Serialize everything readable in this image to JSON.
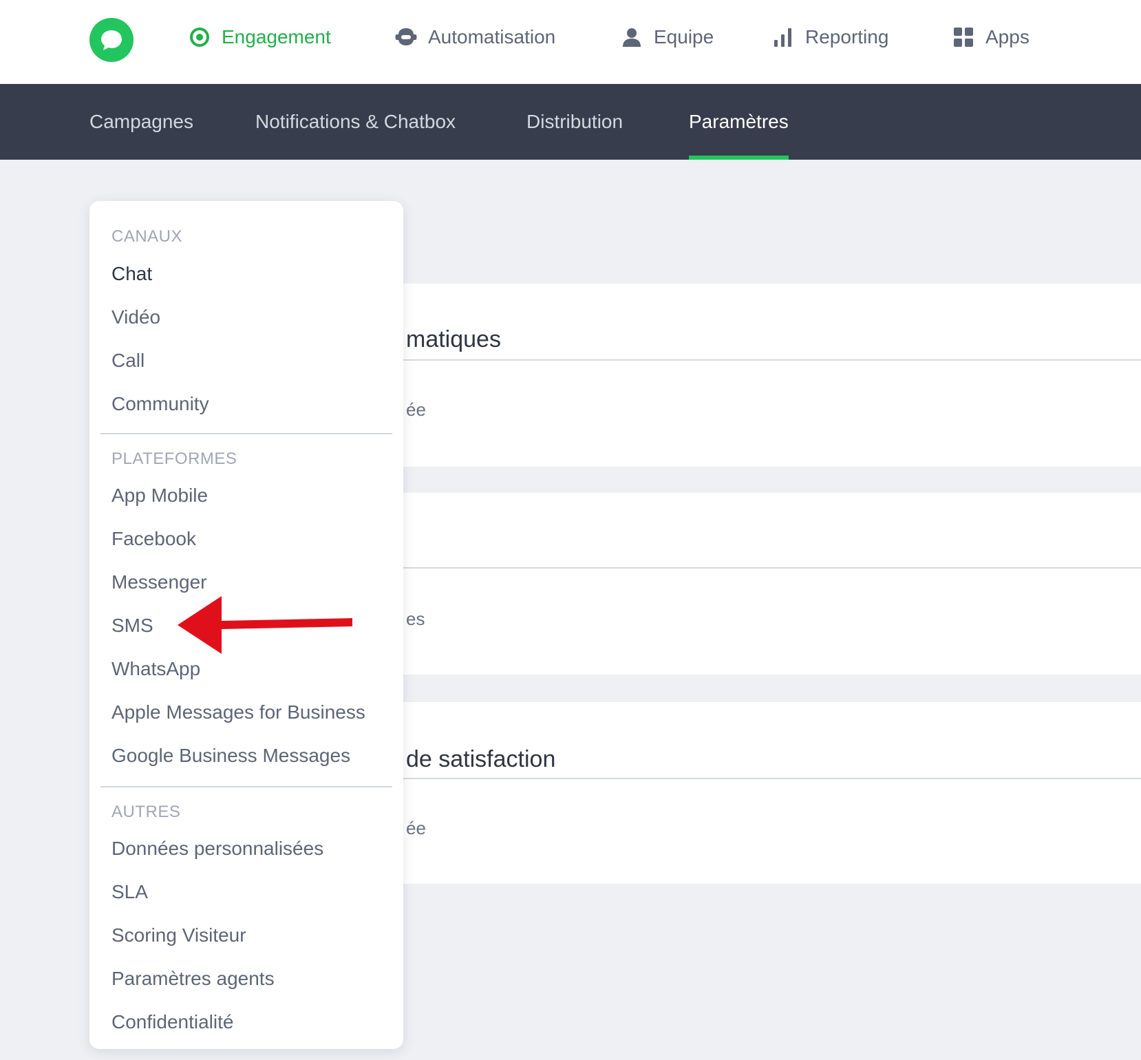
{
  "header": {
    "nav": [
      {
        "label": "Engagement",
        "icon": "target-icon",
        "active": true
      },
      {
        "label": "Automatisation",
        "icon": "robot-icon"
      },
      {
        "label": "Equipe",
        "icon": "user-icon"
      },
      {
        "label": "Reporting",
        "icon": "bar-chart-icon"
      },
      {
        "label": "Apps",
        "icon": "grid-icon"
      }
    ]
  },
  "subnav": {
    "tabs": [
      {
        "label": "Campagnes"
      },
      {
        "label": "Notifications & Chatbox"
      },
      {
        "label": "Distribution"
      },
      {
        "label": "Paramètres",
        "active": true
      }
    ]
  },
  "cards": {
    "c1_title": "matiques",
    "c1_text": "ée",
    "c2_text": "es",
    "c3_title": "de satisfaction",
    "c3_text": "ée"
  },
  "menu": {
    "sections": [
      {
        "title": "CANAUX",
        "items": [
          "Chat",
          "Vidéo",
          "Call",
          "Community"
        ]
      },
      {
        "title": "PLATEFORMES",
        "items": [
          "App Mobile",
          "Facebook",
          "Messenger",
          "SMS",
          "WhatsApp",
          "Apple Messages for Business",
          "Google Business Messages"
        ]
      },
      {
        "title": "AUTRES",
        "items": [
          "Données personnalisées",
          "SLA",
          "Scoring Visiteur",
          "Paramètres agents",
          "Confidentialité"
        ]
      }
    ]
  },
  "colors": {
    "accent": "#22c55e",
    "subnav_bg": "#373d4c",
    "arrow": "#e0101b"
  }
}
